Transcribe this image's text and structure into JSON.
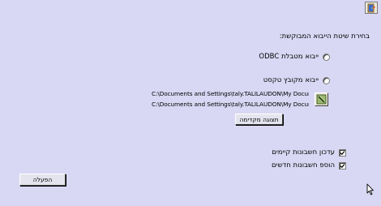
{
  "toolbar": {
    "app_icon": "app-door-icon"
  },
  "import_method": {
    "heading": "בחירת שיטת הייבוא המבוקשת:",
    "options": [
      {
        "label": "ייבוא מטבלת ODBC",
        "selected": false
      },
      {
        "label": "ייבוא מקובץ טקסט",
        "selected": false
      }
    ]
  },
  "paths": [
    "C:\\Documents and Settings\\taly.TALILAUDON\\My Documents\\Dror\\",
    "C:\\Documents and Settings\\taly.TALILAUDON\\My Documents\\Dror\\"
  ],
  "browse": {
    "icon": "browse-folder-icon"
  },
  "preview_button": {
    "label": "תצוגה מקדימה"
  },
  "options": [
    {
      "label": "עדכון חשבונות קיימים",
      "checked": true
    },
    {
      "label": "הוספ חשבונות חדשים",
      "checked": true
    }
  ],
  "run_button": {
    "label": "הפעלה"
  }
}
